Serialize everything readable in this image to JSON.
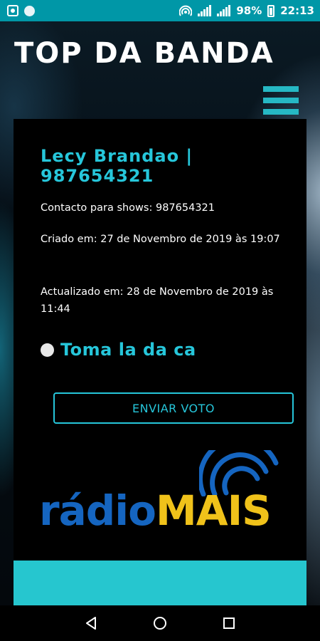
{
  "status_bar": {
    "battery": "98%",
    "time": "22:13"
  },
  "header": {
    "title": "TOP DA BANDA"
  },
  "card": {
    "artist_heading": "Lecy Brandao | 987654321",
    "contact": "Contacto para shows: 987654321",
    "created": "Criado em: 27 de Novembro de 2019 às 19:07",
    "updated": "Actualizado em: 28 de Novembro de 2019 às 11:44",
    "song_option": "Toma la da ca",
    "vote_button": "ENVIAR VOTO"
  },
  "logo": {
    "text_part1": "rádio",
    "text_part2": "MAIS"
  },
  "colors": {
    "accent": "#26c6da",
    "status_bar": "#0097a7",
    "logo_blue": "#1565c0",
    "logo_yellow": "#f0c21a"
  }
}
